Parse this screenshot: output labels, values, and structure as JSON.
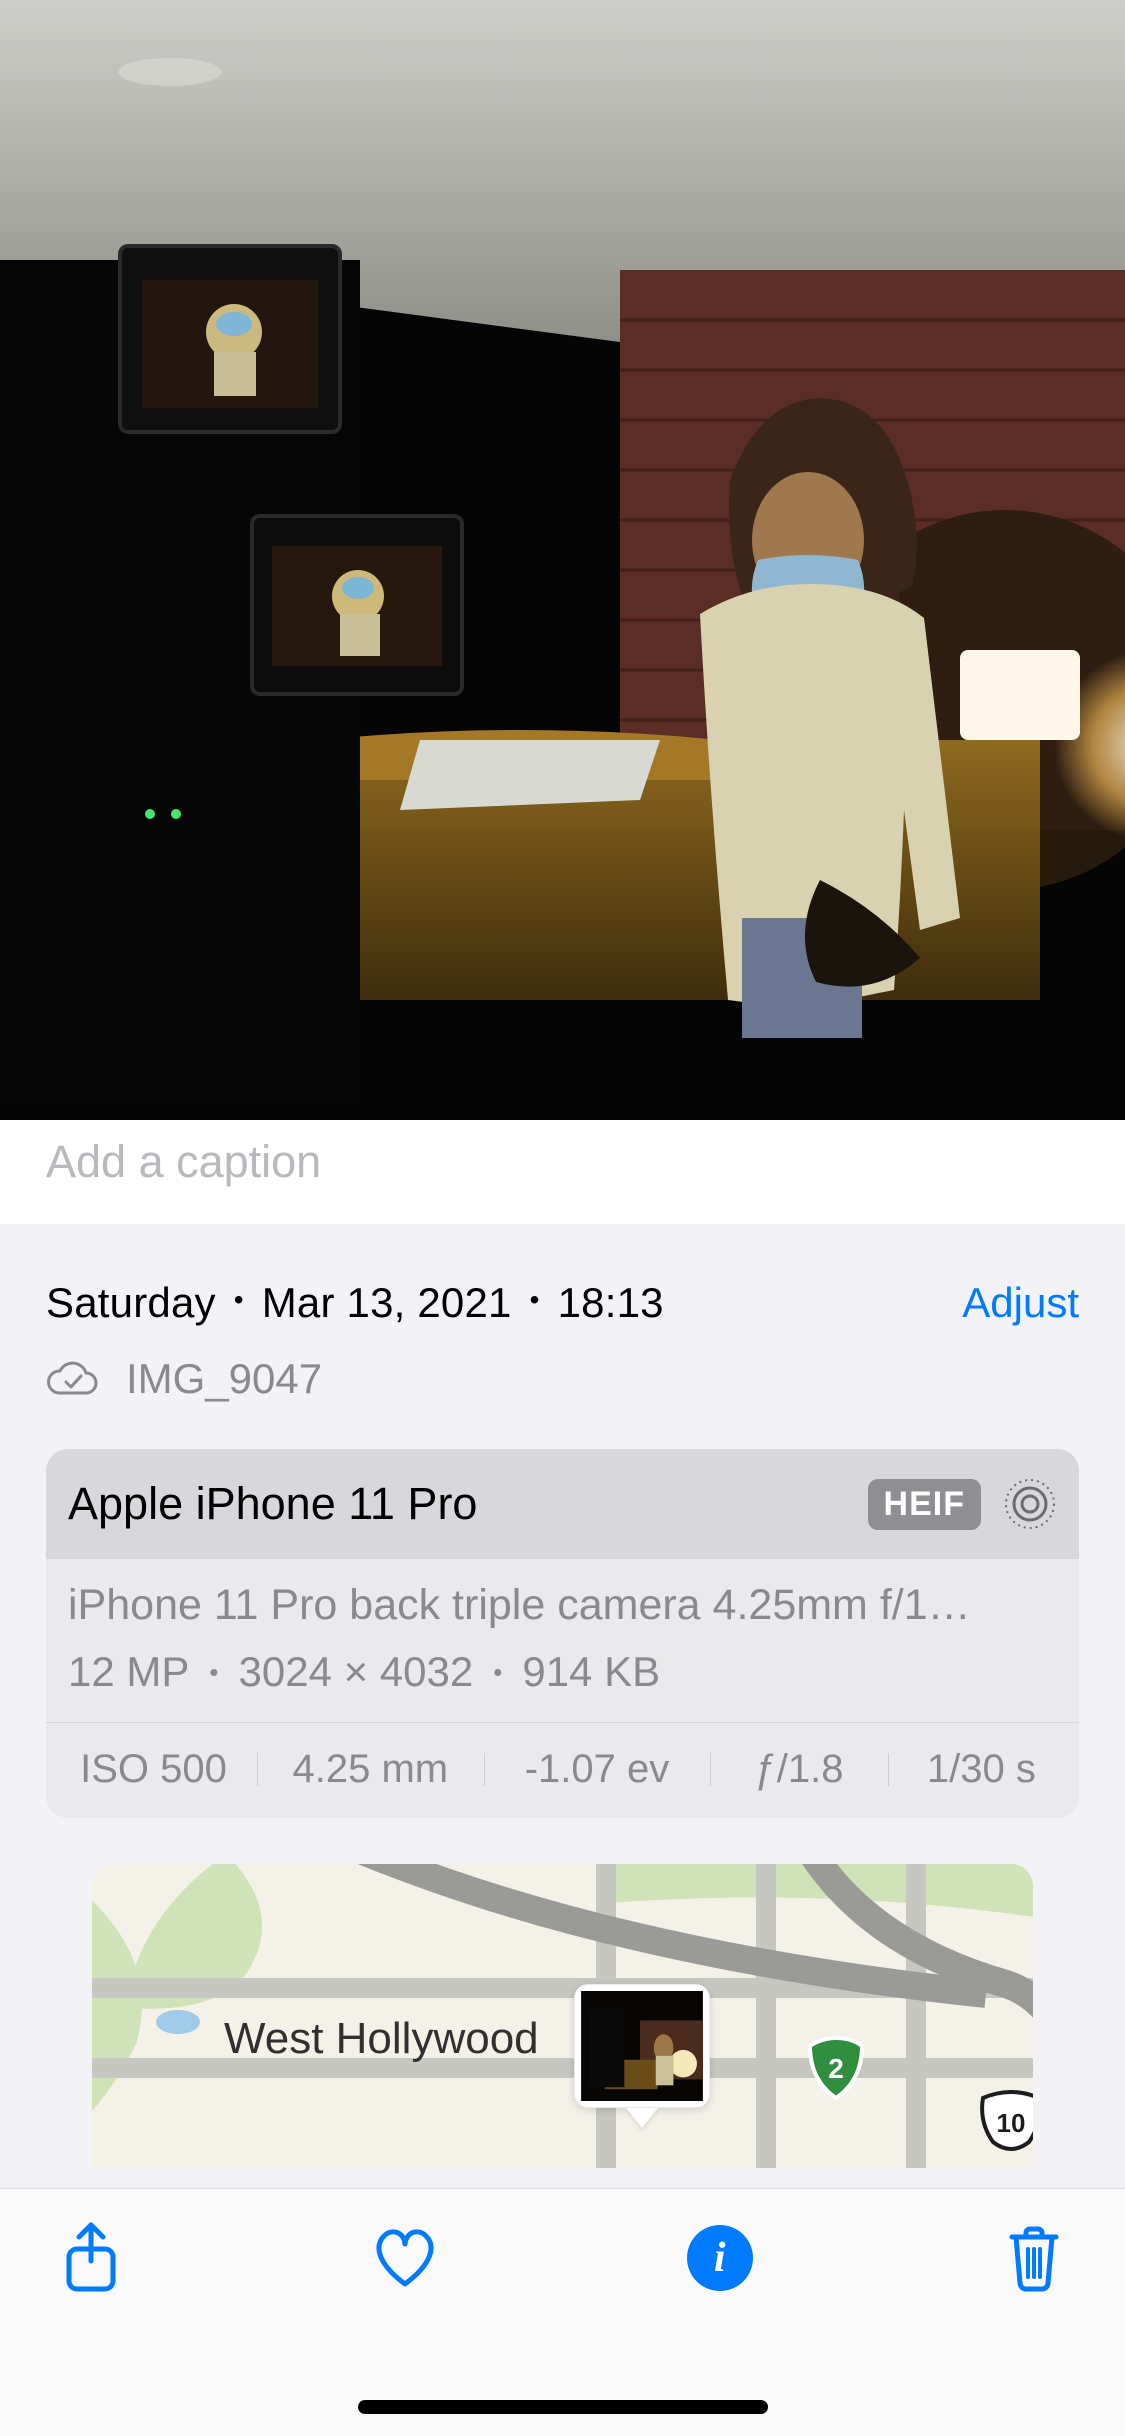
{
  "caption": {
    "placeholder": "Add a caption"
  },
  "meta": {
    "day": "Saturday",
    "date": "Mar 13, 2021",
    "time": "18:13",
    "adjust_label": "Adjust",
    "filename": "IMG_9047"
  },
  "camera": {
    "device": "Apple iPhone 11 Pro",
    "format_badge": "HEIF",
    "lens": "iPhone 11 Pro back triple camera 4.25mm f/1…",
    "megapixels": "12 MP",
    "dimensions": "3024 × 4032",
    "filesize": "914 KB",
    "exif": {
      "iso": "ISO 500",
      "focal": "4.25 mm",
      "ev": "-1.07 ev",
      "aperture": "ƒ/1.8",
      "shutter": "1/30 s"
    }
  },
  "map": {
    "city_label": "West Hollywood",
    "route_2": "2",
    "route_10": "10"
  },
  "toolbar": {
    "share": "Share",
    "favorite": "Favorite",
    "info": "Info",
    "delete": "Delete"
  },
  "colors": {
    "accent": "#007aff",
    "muted": "#8a8a8e"
  }
}
